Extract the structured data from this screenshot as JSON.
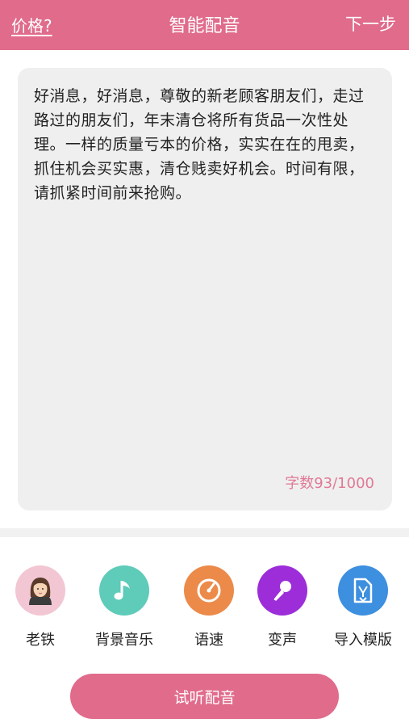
{
  "header": {
    "price_link": "价格?",
    "title": "智能配音",
    "next_label": "下一步"
  },
  "editor": {
    "content": "好消息，好消息，尊敬的新老顾客朋友们，走过路过的朋友们，年末清仓将所有货品一次性处理。一样的质量亏本的价格，实实在在的甩卖，抓住机会买实惠，清仓贱卖好机会。时间有限，请抓紧时间前来抢购。",
    "char_count": "字数93/1000"
  },
  "tools": [
    {
      "label": "老铁",
      "icon": "woman-avatar-icon",
      "color": "#f2c6d3"
    },
    {
      "label": "背景音乐",
      "icon": "music-note-icon",
      "color": "#5fcbb9"
    },
    {
      "label": "语速",
      "icon": "speedometer-icon",
      "color": "#ec8a4a"
    },
    {
      "label": "变声",
      "icon": "microphone-icon",
      "color": "#9c2dd9"
    },
    {
      "label": "导入模版",
      "icon": "document-import-icon",
      "color": "#3d8fdf"
    }
  ],
  "listen_button": "试听配音",
  "colors": {
    "accent": "#e06b8b",
    "count_text": "#e07a96"
  }
}
